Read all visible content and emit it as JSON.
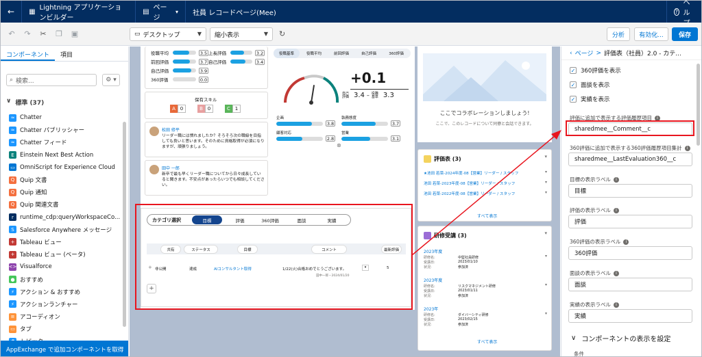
{
  "app": {
    "builder_title": "Lightning アプリケーションビルダー",
    "page_menu": "ページ",
    "record_page": "社員 レコードページ(Mee)",
    "help": "ヘルプ"
  },
  "toolbar": {
    "device": "デスクトップ",
    "view": "縮小表示",
    "analyze": "分析",
    "activate": "有効化...",
    "save": "保存"
  },
  "left": {
    "tabs": [
      "コンポーネント",
      "項目"
    ],
    "search_placeholder": "検索...",
    "section_title": "標準 (37)",
    "components": [
      {
        "label": "Chatter",
        "color": "#1b96ff",
        "icon": "≈"
      },
      {
        "label": "Chatter パブリッシャー",
        "color": "#1b96ff",
        "icon": "≈"
      },
      {
        "label": "Chatter フィード",
        "color": "#1b96ff",
        "icon": "≈"
      },
      {
        "label": "Einstein Next Best Action",
        "color": "#0b827c",
        "icon": "E"
      },
      {
        "label": "OmniScript for Experience Cloud",
        "color": "#0176d3",
        "icon": "▭"
      },
      {
        "label": "Quip 文書",
        "color": "#f46f3e",
        "icon": "Q"
      },
      {
        "label": "Quip 通知",
        "color": "#f46f3e",
        "icon": "Q"
      },
      {
        "label": "Quip 関連文書",
        "color": "#f46f3e",
        "icon": "Q"
      },
      {
        "label": "runtime_cdp:queryWorkspaceCo...",
        "color": "#032d60",
        "icon": "r"
      },
      {
        "label": "Salesforce Anywhere メッセージ",
        "color": "#1b96ff",
        "icon": "S"
      },
      {
        "label": "Tableau ビュー",
        "color": "#c23934",
        "icon": "+"
      },
      {
        "label": "Tableau ビュー (ベータ)",
        "color": "#c23934",
        "icon": "+"
      },
      {
        "label": "Visualforce",
        "color": "#8e44ad",
        "icon": "<>"
      },
      {
        "label": "おすすめ",
        "color": "#45c65a",
        "icon": "●"
      },
      {
        "label": "アクション & おすすめ",
        "color": "#1b96ff",
        "icon": "⚡"
      },
      {
        "label": "アクションランチャー",
        "color": "#1b96ff",
        "icon": "⚡"
      },
      {
        "label": "アコーディオン",
        "color": "#fe9339",
        "icon": "≡"
      },
      {
        "label": "タブ",
        "color": "#fe9339",
        "icon": "▭"
      },
      {
        "label": "トピック",
        "color": "#1b96ff",
        "icon": "#"
      }
    ],
    "appexchange": "AppExchange で追加コンポーネントを取得"
  },
  "canvas": {
    "scores_left": [
      {
        "label": "役職平均",
        "value": "3.5",
        "fill": 0.7
      },
      {
        "label": "前回評価",
        "value": "3.7",
        "fill": 0.74
      },
      {
        "label": "自己評価",
        "value": "3.9",
        "fill": 0.78
      },
      {
        "label": "360評価",
        "value": "0.0",
        "fill": 0
      }
    ],
    "scores_right": [
      {
        "label": "上長評価",
        "value": "3.2",
        "fill": 0.64
      },
      {
        "label": "自己評価",
        "value": "3.4",
        "fill": 0.68
      }
    ],
    "skills_title": "保有スキル",
    "skills": [
      {
        "letter": "A",
        "count": "0",
        "color": "#e8693a"
      },
      {
        "letter": "B",
        "count": "0",
        "color": "#e8a0a0"
      },
      {
        "letter": "C",
        "count": "1",
        "color": "#5ab55a"
      }
    ],
    "comments": [
      {
        "name": "松田 修平",
        "text": "リーダー職には慣れましたか？そろそろ次の職級を目指しても良いと思います。そのために資格取得が必須になりますが、頑張りましょう。"
      },
      {
        "name": "田中 一郎",
        "text": "新卒で最も早くリーダー職についてから日々成長していると聞きます。不安点があったらいつでも相談してください。"
      }
    ],
    "gauge_tabs": [
      "役職基準",
      "役職平均",
      "前回評価",
      "自己評価",
      "360評価"
    ],
    "gauge_score": "+0.1",
    "gauge_self_label": "自己評価",
    "gauge_self_value": "3.4",
    "gauge_base_label": "役職基準",
    "gauge_base_value": "3.3",
    "gauge_level": 0.55,
    "metrics": [
      {
        "label": "企画",
        "value": "3.8",
        "fill": 0.76
      },
      {
        "label": "執務態度",
        "value": "3.7",
        "fill": 0.74
      },
      {
        "label": "顧客対応",
        "value": "2.8",
        "fill": 0.56
      },
      {
        "label": "営業",
        "value": "3.1",
        "fill": 0.62
      }
    ],
    "category_label": "カテゴリ選択",
    "category_tabs": [
      "目標",
      "評価",
      "360評価",
      "面談",
      "実績"
    ],
    "table_headers": [
      "共有",
      "ステータス",
      "目標",
      "コメント",
      "最新評価"
    ],
    "table_row": {
      "share": "非公開",
      "status": "達成",
      "goal": "AIコンサルタント取得",
      "comment": "1/22(火)合格おめでとうございます。",
      "latest": "5",
      "byline": "田中一郎・2024/01/20"
    },
    "collab_title": "ここでコラボレーションしましょう!",
    "collab_sub": "ここで、このレコードについて同僚と会話できます。",
    "eval_title": "評価表 (3)",
    "eval_items": [
      "★池田 若菜-2024年度-08【営業】リーダー / スタッフ",
      "池田 若菜-2023年度-08【営業】リーダー / スタッフ",
      "池田 若菜-2022年度-08【営業】リーダー / スタッフ"
    ],
    "show_all": "すべて表示",
    "training_title": "研修受講 (3)",
    "trainings": [
      {
        "year": "2023年度",
        "name": "中堅社員研修",
        "date": "2023/01/10",
        "status": "参加済"
      },
      {
        "year": "2023年度",
        "name": "リスクマネジメント研修",
        "date": "2023/01/11",
        "status": "参加済"
      },
      {
        "year": "2023年",
        "name": "ダイバーシティ研修",
        "date": "2023/02/15",
        "status": "参加済"
      }
    ],
    "training_fields": [
      "研修名:",
      "受講日:",
      "状況:"
    ]
  },
  "right": {
    "breadcrumb_page": "ページ",
    "breadcrumb_title": "評価表（社員）2.0 - カテ...",
    "checkboxes": [
      "360評価を表示",
      "面談を表示",
      "実績を表示"
    ],
    "fields": [
      {
        "label": "評価に追加で表示する評価履歴項目",
        "value": "sharedmee__Comment__c"
      },
      {
        "label": "360評価に追加で表示する360評価履歴項目集計",
        "value": "sharedmee__LastEvaluation360__c"
      },
      {
        "label": "目標の表示ラベル",
        "value": "目標"
      },
      {
        "label": "評価の表示ラベル",
        "value": "評価"
      },
      {
        "label": "360評価の表示ラベル",
        "value": "360評価"
      },
      {
        "label": "面談の表示ラベル",
        "value": "面談"
      },
      {
        "label": "実績の表示ラベル",
        "value": "実績"
      }
    ],
    "section": "コンポーネントの表示を設定",
    "condition": "条件"
  }
}
